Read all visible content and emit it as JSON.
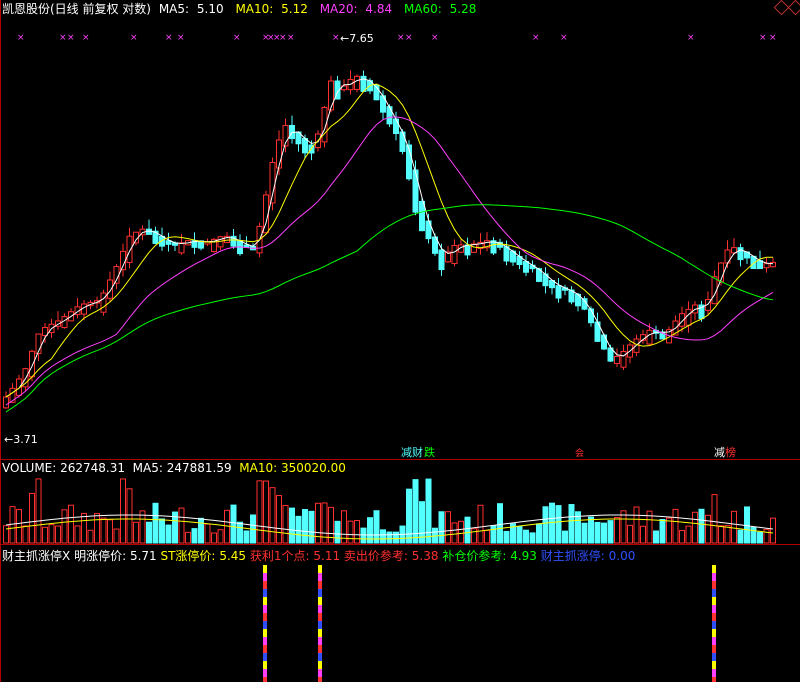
{
  "colors": {
    "bg": "#000000",
    "up": "#ff3030",
    "down": "#54ffff",
    "ma5": "#ffffff",
    "ma10": "#ffff00",
    "ma20": "#ff40ff",
    "ma60": "#00ff00",
    "sep": "#b00000",
    "text": "#ffffff"
  },
  "main": {
    "title": "凯恩股份(日线 前复权 对数)",
    "ma5_label": "MA5:",
    "ma5_value": "5.10",
    "ma10_label": "MA10:",
    "ma10_value": "5.12",
    "ma20_label": "MA20:",
    "ma20_value": "4.84",
    "ma60_label": "MA60:",
    "ma60_value": "5.28",
    "high_label": "7.65",
    "low_label": "3.71",
    "annotations": [
      {
        "text": "减",
        "color": "#54ffff"
      },
      {
        "text": "财",
        "color": "#54ffff"
      },
      {
        "text": "跌",
        "color": "#00ff00"
      },
      {
        "text": "会",
        "color": "#ff3030"
      },
      {
        "text": "减",
        "color": "#ffffff"
      },
      {
        "text": "榜",
        "color": "#ff3030"
      }
    ]
  },
  "volume": {
    "label": "VOLUME:",
    "value": "262748.31",
    "ma5_label": "MA5:",
    "ma5_value": "247881.59",
    "ma10_label": "MA10:",
    "ma10_value": "350020.00"
  },
  "indicator": {
    "name": "财主抓涨停X",
    "items": [
      {
        "label": "明涨停价:",
        "value": "5.71",
        "color": "#ffffff"
      },
      {
        "label": "ST涨停价:",
        "value": "5.45",
        "color": "#ffff00"
      },
      {
        "label": "获利1个点:",
        "value": "5.11",
        "color": "#ff3030"
      },
      {
        "label": "卖出价参考:",
        "value": "5.38",
        "color": "#ff3030"
      },
      {
        "label": "补仓价参考:",
        "value": "4.93",
        "color": "#00ff00"
      },
      {
        "label": "财主抓涨停:",
        "value": "0.00",
        "color": "#3050ff"
      }
    ]
  },
  "icons": {
    "corner": "diamond-icon"
  }
}
